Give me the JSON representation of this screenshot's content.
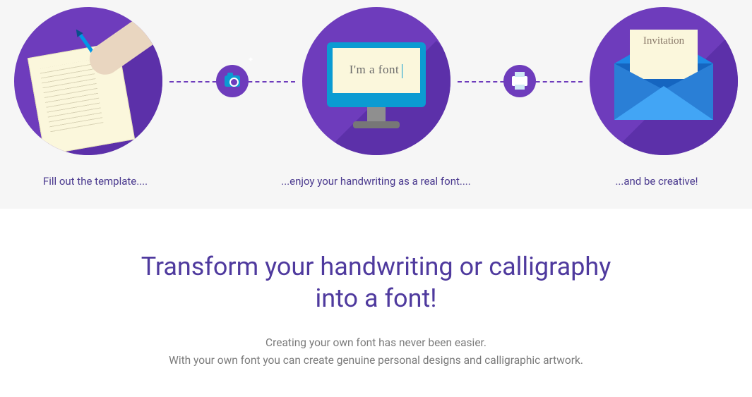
{
  "steps": {
    "step1_caption": "Fill out the template....",
    "step2_caption": "...enjoy your handwriting as a real font....",
    "step3_caption": "...and be creative!",
    "monitor_text": "I'm a font",
    "invitation_text": "Invitation"
  },
  "headline": "Transform your handwriting or calligraphy into a font!",
  "sub1": "Creating your own font has never been easier.",
  "sub2": "With your own font you can create genuine personal designs and calligraphic artwork.",
  "colors": {
    "primary": "#6e3cbc",
    "primary_dark": "#5a2fa6",
    "accent_blue": "#0b9bd2",
    "paper": "#fbf7dc",
    "text_purple": "#4b3a8f",
    "text_gray": "#7a7a7a"
  },
  "icons": {
    "connector1": "camera-icon",
    "connector2": "printer-icon"
  }
}
